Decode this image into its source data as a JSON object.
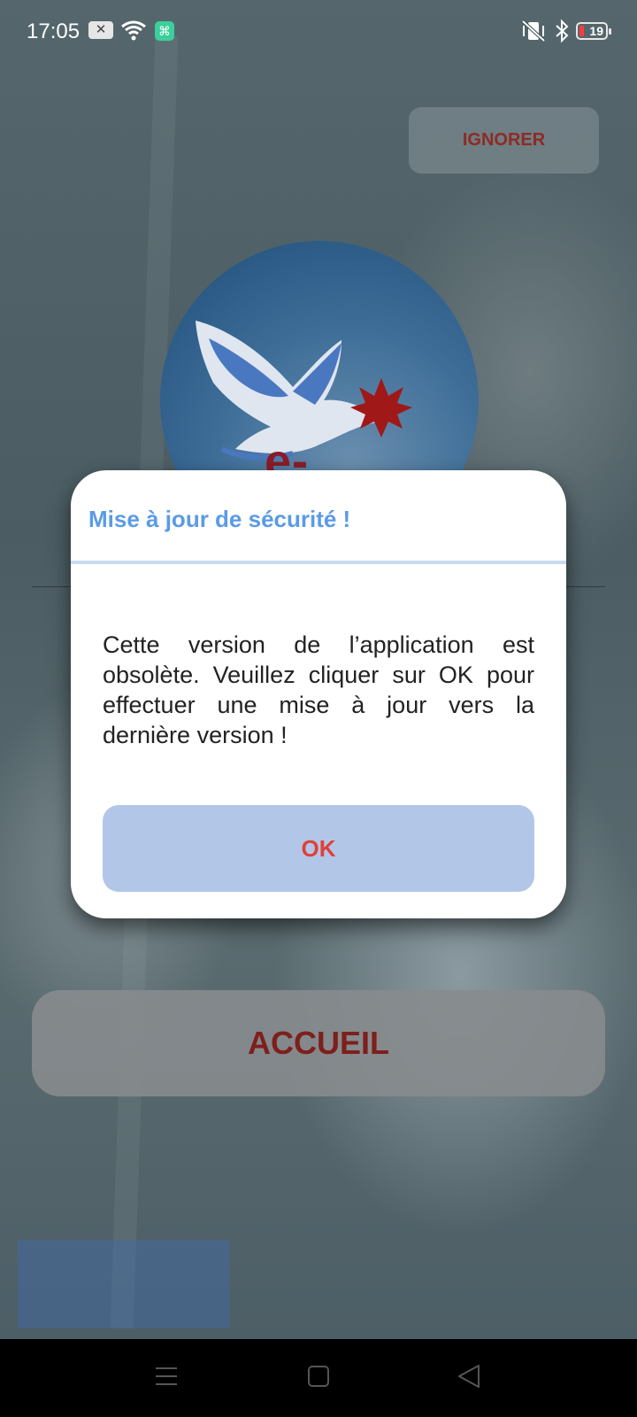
{
  "status_bar": {
    "time": "17:05",
    "battery_level": "19",
    "icons": [
      "notification-x-icon",
      "wifi-icon",
      "app-notification-icon",
      "vibrate-off-icon",
      "bluetooth-icon",
      "battery-icon"
    ]
  },
  "header": {
    "ignore_label": "IGNORER"
  },
  "logo": {
    "text": "e-canada"
  },
  "main": {
    "home_label": "ACCUEIL"
  },
  "dialog": {
    "title": "Mise à jour de sécurité !",
    "message": "Cette version de l’application est obsolète. Veuillez cliquer sur OK pour effectuer une mise à jour vers la dernière version !",
    "ok_label": "OK"
  },
  "colors": {
    "dialog_title": "#5b9be6",
    "ok_button_bg": "#b2c7e8",
    "ok_button_text": "#e0403a",
    "home_text": "#7e1f1c"
  },
  "nav_bar": {
    "icons": [
      "menu-icon",
      "home-square-icon",
      "back-triangle-icon"
    ]
  }
}
